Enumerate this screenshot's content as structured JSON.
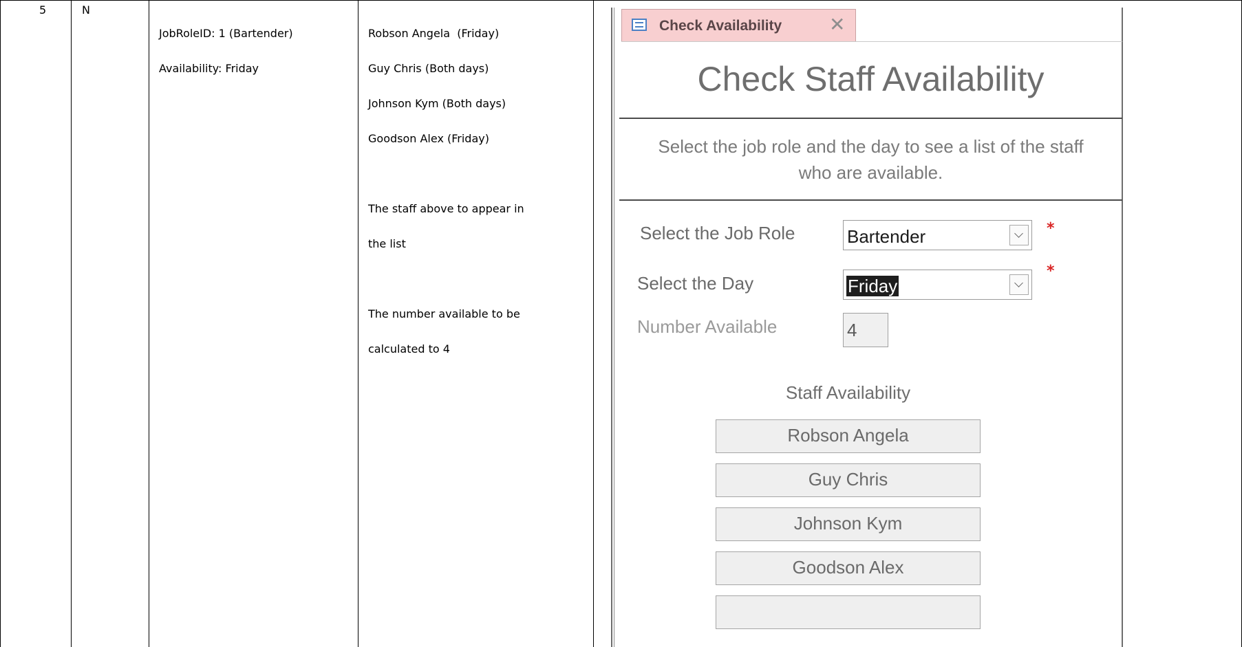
{
  "test_row": {
    "number": "5",
    "flag": "N",
    "test_data": [
      "JobRoleID: 1 (Bartender)",
      "Availability: Friday"
    ],
    "expected_staff": [
      "Robson Angela  (Friday)",
      "Guy Chris (Both days)",
      "Johnson Kym (Both days)",
      "Goodson Alex (Friday)"
    ],
    "expected_note_1": [
      "The staff above to appear in",
      "the list"
    ],
    "expected_note_2": [
      "The number available to be",
      "calculated to 4"
    ]
  },
  "access_form": {
    "tab_title": "Check Availability",
    "tab_icon": "form-icon",
    "close_icon": "close-icon",
    "title": "Check Staff Availability",
    "instruction_line1": "Select the job role and the day to see a list of the staff",
    "instruction_line2": "who are available.",
    "job_role": {
      "label": "Select the Job Role",
      "value": "Bartender",
      "required_mark": "*"
    },
    "day": {
      "label": "Select the Day",
      "value": "Friday",
      "required_mark": "*"
    },
    "number_available": {
      "label": "Number Available",
      "value": "4"
    },
    "staff_list": {
      "heading": "Staff Availability",
      "names": [
        "Robson Angela",
        "Guy Chris",
        "Johnson Kym",
        "Goodson Alex",
        ""
      ]
    },
    "colors": {
      "tab_background": "#f8cfd0",
      "required": "#d92525",
      "title_text": "#6e6e6e"
    }
  }
}
